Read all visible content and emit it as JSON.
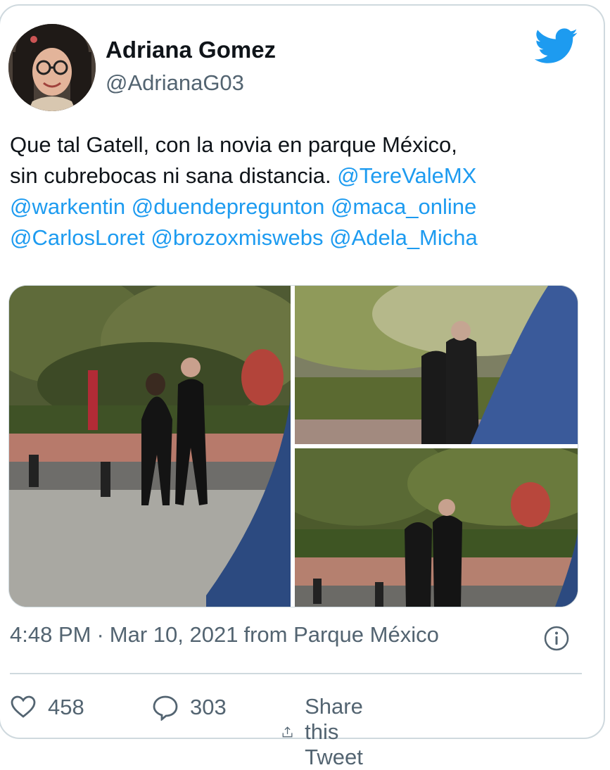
{
  "tweet": {
    "author_name": "Adriana Gomez",
    "author_handle": "@AdrianaG03",
    "text_plain_1": "Que tal Gatell, con la novia en parque México,",
    "text_plain_2": "sin cubrebocas ni sana distancia.",
    "mentions": [
      "@TereValeMX",
      "@warkentin",
      "@duendepregunton",
      "@maca_online",
      "@CarlosLoret",
      "@brozoxmiswebs",
      "@Adela_Micha"
    ],
    "time": "4:48 PM",
    "separator": "·",
    "date": "Mar 10, 2021",
    "source": "from Parque México",
    "likes": "458",
    "replies": "303",
    "share_label": "Share this Tweet"
  },
  "icons": {
    "brand": "twitter-bird-icon",
    "info": "info-icon",
    "like": "heart-icon",
    "reply": "reply-bubble-icon",
    "share": "share-icon"
  },
  "colors": {
    "link": "#1d9bf0",
    "text": "#0f1419",
    "secondary": "#536471",
    "border": "#cfd9de"
  }
}
